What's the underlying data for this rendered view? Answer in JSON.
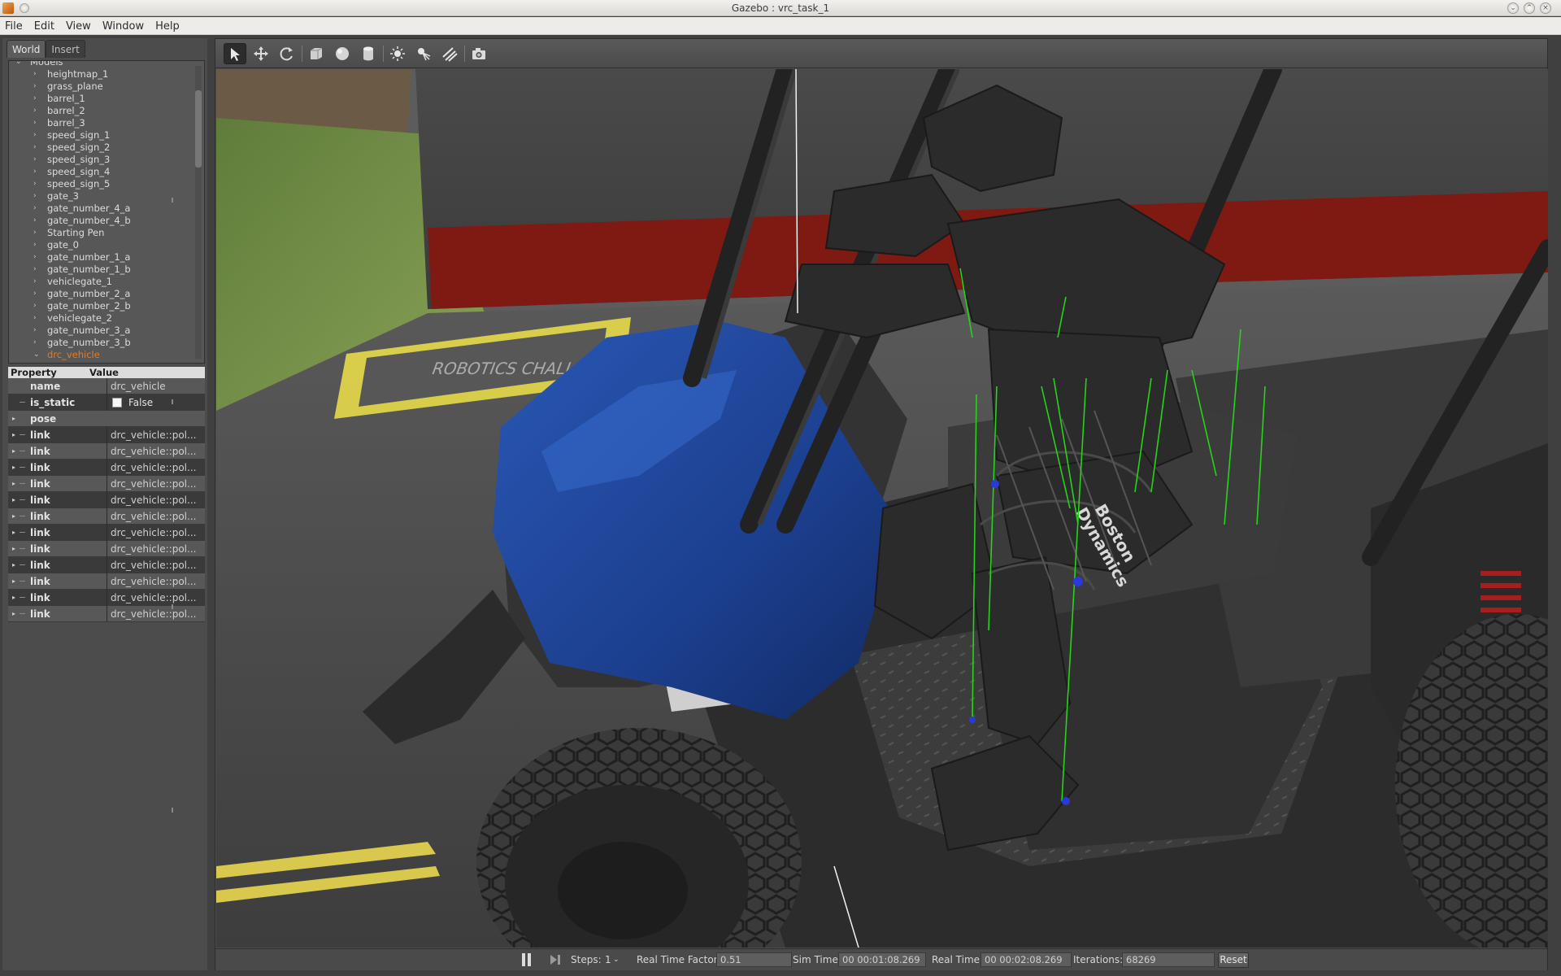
{
  "window": {
    "title": "Gazebo : vrc_task_1"
  },
  "menu": {
    "items": [
      "File",
      "Edit",
      "View",
      "Window",
      "Help"
    ]
  },
  "left_panel": {
    "tabs": [
      {
        "label": "World",
        "active": true
      },
      {
        "label": "Insert",
        "active": false
      }
    ],
    "tree": {
      "root_label": "Models",
      "items": [
        "heightmap_1",
        "grass_plane",
        "barrel_1",
        "barrel_2",
        "barrel_3",
        "speed_sign_1",
        "speed_sign_2",
        "speed_sign_3",
        "speed_sign_4",
        "speed_sign_5",
        "gate_3",
        "gate_number_4_a",
        "gate_number_4_b",
        "Starting Pen",
        "gate_0",
        "gate_number_1_a",
        "gate_number_1_b",
        "vehiclegate_1",
        "gate_number_2_a",
        "gate_number_2_b",
        "vehiclegate_2",
        "gate_number_3_a",
        "gate_number_3_b",
        "drc_vehicle"
      ],
      "selected": "drc_vehicle"
    },
    "properties": {
      "header_property": "Property",
      "header_value": "Value",
      "name_label": "name",
      "name_value": "drc_vehicle",
      "is_static_label": "is_static",
      "is_static_value": "False",
      "pose_label": "pose",
      "link_label": "link",
      "link_value": "drc_vehicle::pol...",
      "link_count": 12
    }
  },
  "toolbar": {
    "tools": [
      "select-arrow-icon",
      "translate-icon",
      "rotate-icon",
      "box-icon",
      "sphere-icon",
      "cylinder-icon",
      "point-light-icon",
      "spot-light-icon",
      "directional-light-icon",
      "screenshot-camera-icon"
    ]
  },
  "scene": {
    "decal_text": "ROBOTICS CHALLENGE",
    "vehicle_logo_line1": "Boston",
    "vehicle_logo_line2": "Dynamics"
  },
  "statusbar": {
    "steps_label": "Steps:",
    "steps_value": "1",
    "rtf_label": "Real Time Factor:",
    "rtf_value": "0.51",
    "sim_time_label": "Sim Time:",
    "sim_time_value": "00 00:01:08.269",
    "real_time_label": "Real Time:",
    "real_time_value": "00 00:02:08.269",
    "iterations_label": "Iterations:",
    "iterations_value": "68269",
    "reset_label": "Reset"
  },
  "colors": {
    "selected_text": "#e07b2a",
    "vehicle_blue": "#1c3f8f",
    "wall_red": "#8b1a12"
  }
}
